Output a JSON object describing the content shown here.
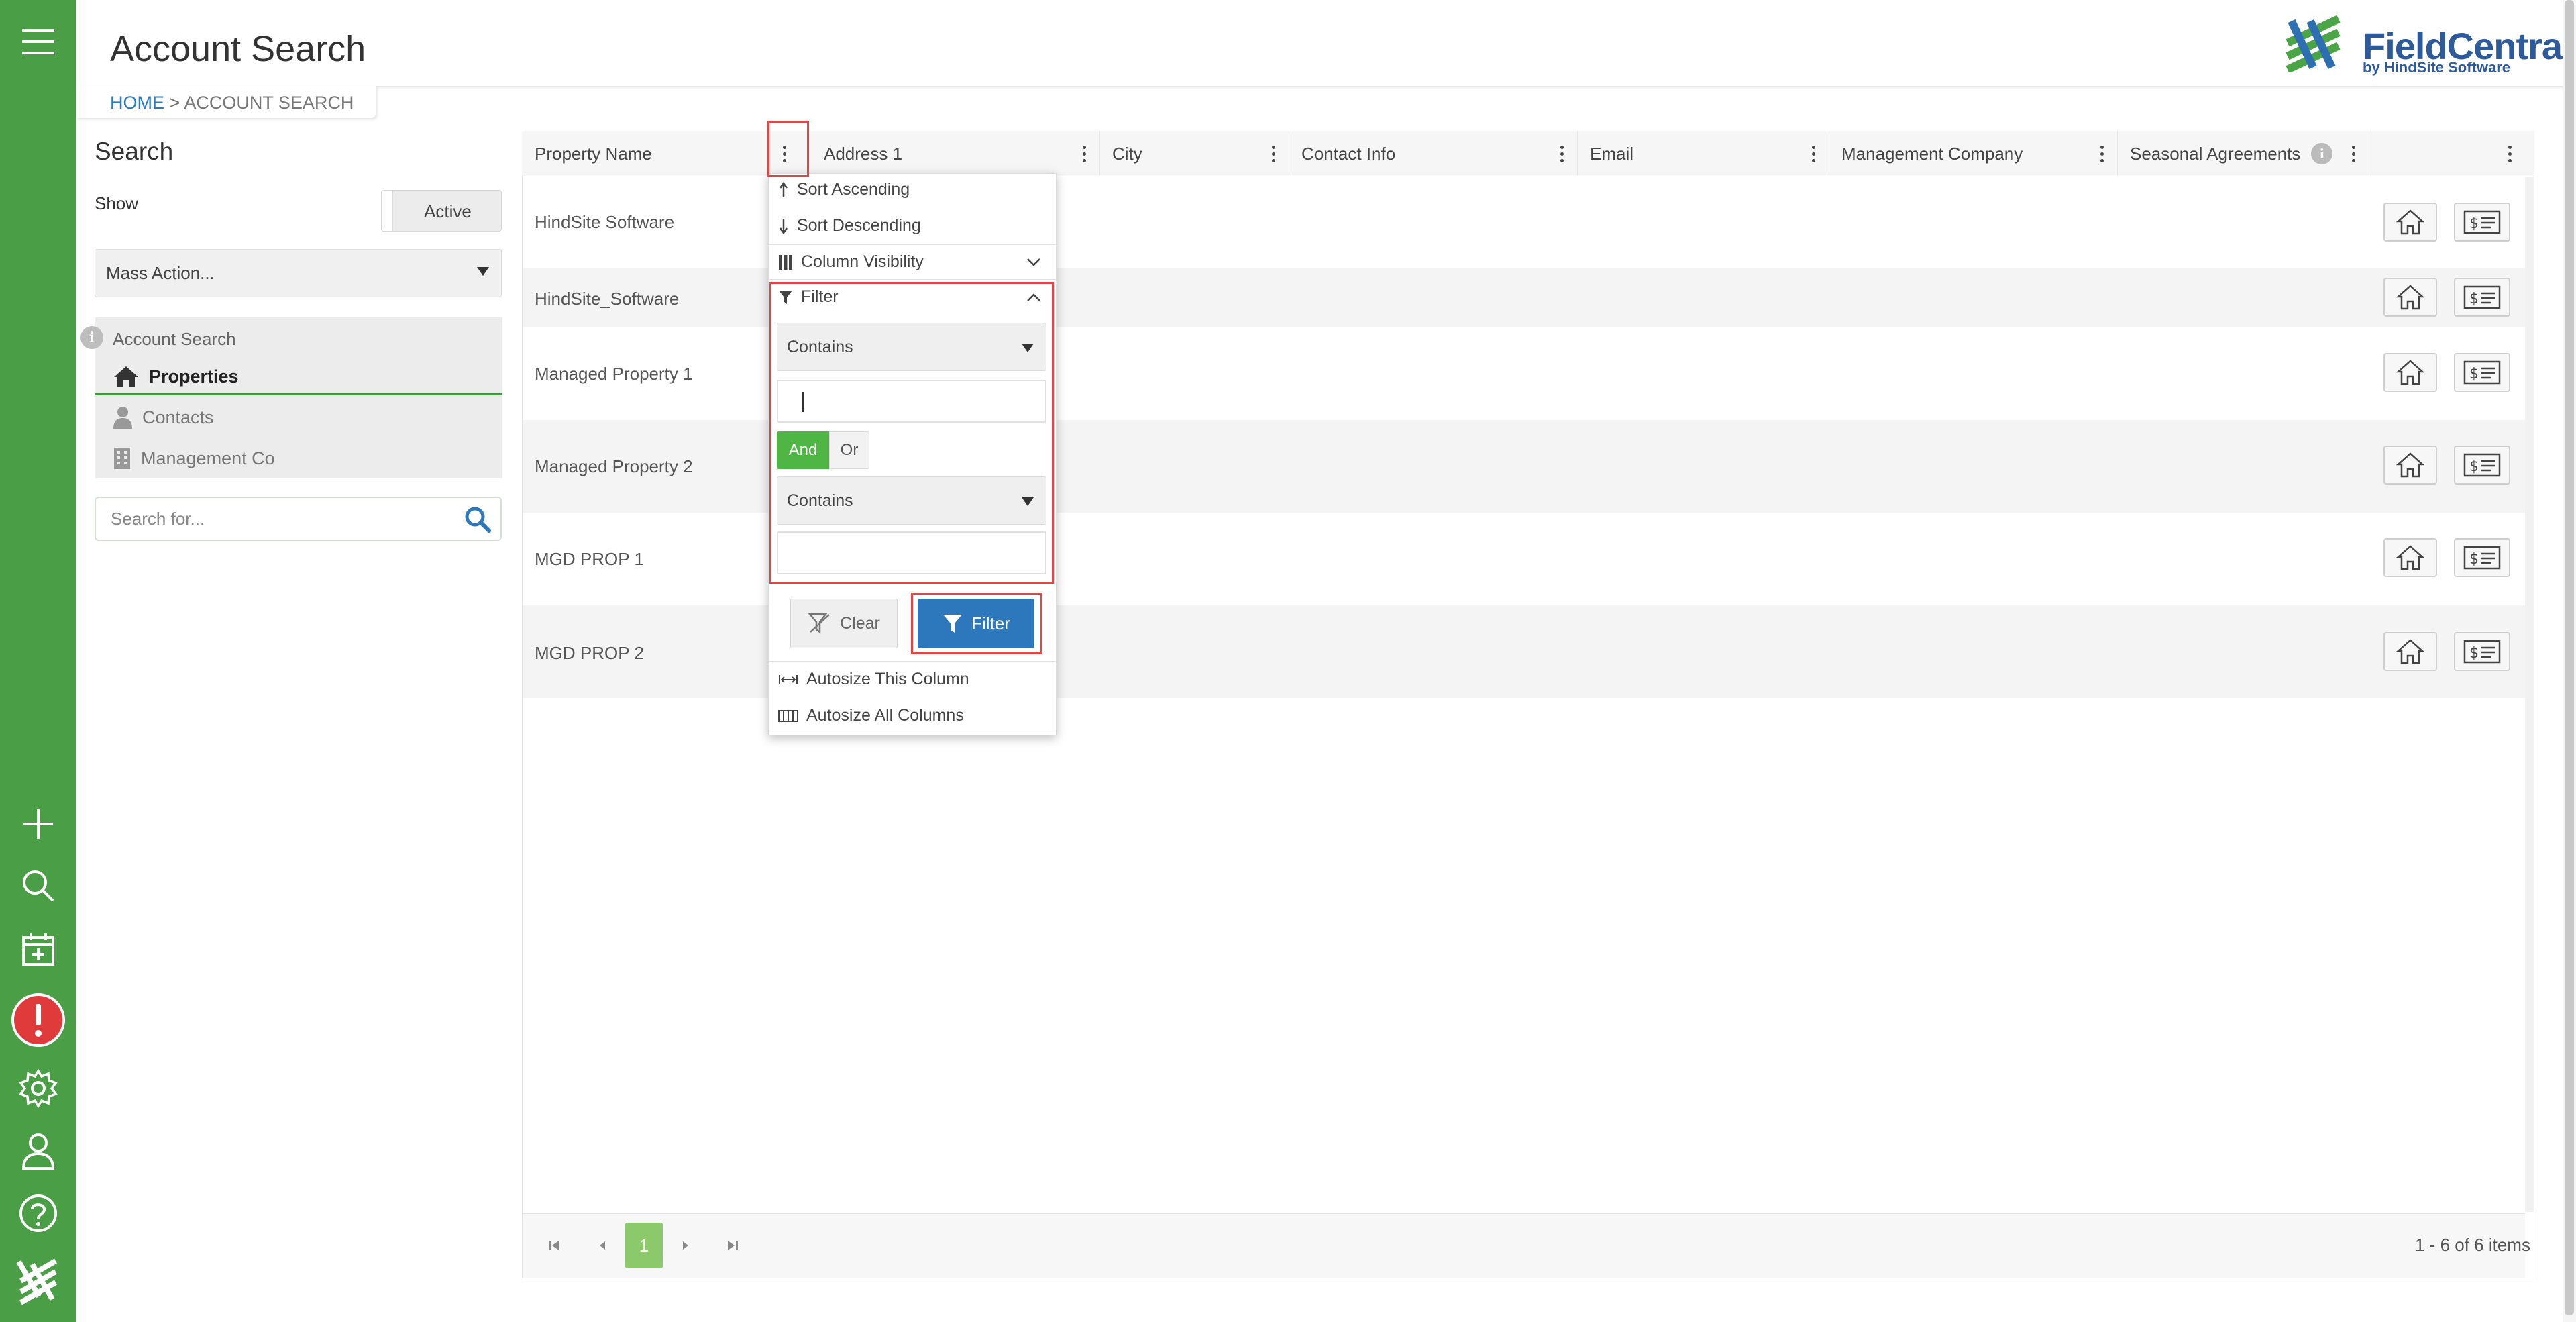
{
  "header": {
    "title": "Account Search"
  },
  "breadcrumb": {
    "home": "HOME",
    "separator": ">",
    "current": "ACCOUNT SEARCH"
  },
  "logo": {
    "name": "FieldCentral",
    "sub": "by HindSite Software"
  },
  "search_panel": {
    "title": "Search",
    "show_label": "Show",
    "toggle_label": "Active",
    "mass_action": "Mass Action...",
    "nav_header": "Account Search",
    "nav_items": [
      "Properties",
      "Contacts",
      "Management Co"
    ],
    "search_placeholder": "Search for..."
  },
  "grid": {
    "columns": [
      "Property Name",
      "Address 1",
      "City",
      "Contact Info",
      "Email",
      "Management Company",
      "Seasonal Agreements"
    ],
    "rows": [
      "HindSite Software",
      "HindSite_Software",
      "Managed Property 1",
      "Managed Property 2",
      "MGD PROP 1",
      "MGD PROP 2"
    ]
  },
  "column_menu": {
    "sort_asc": "Sort Ascending",
    "sort_desc": "Sort Descending",
    "column_visibility": "Column Visibility",
    "filter_header": "Filter",
    "operator1": "Contains",
    "operator2": "Contains",
    "logic_and": "And",
    "logic_or": "Or",
    "clear": "Clear",
    "filter": "Filter",
    "autosize_one": "Autosize This Column",
    "autosize_all": "Autosize All Columns"
  },
  "pager": {
    "current_page": "1",
    "info": "1 - 6 of 6 items"
  },
  "colors": {
    "rail": "#4a9e45",
    "primary": "#2d77bd",
    "accent_green": "#8cc96a",
    "highlight": "#e04646"
  }
}
